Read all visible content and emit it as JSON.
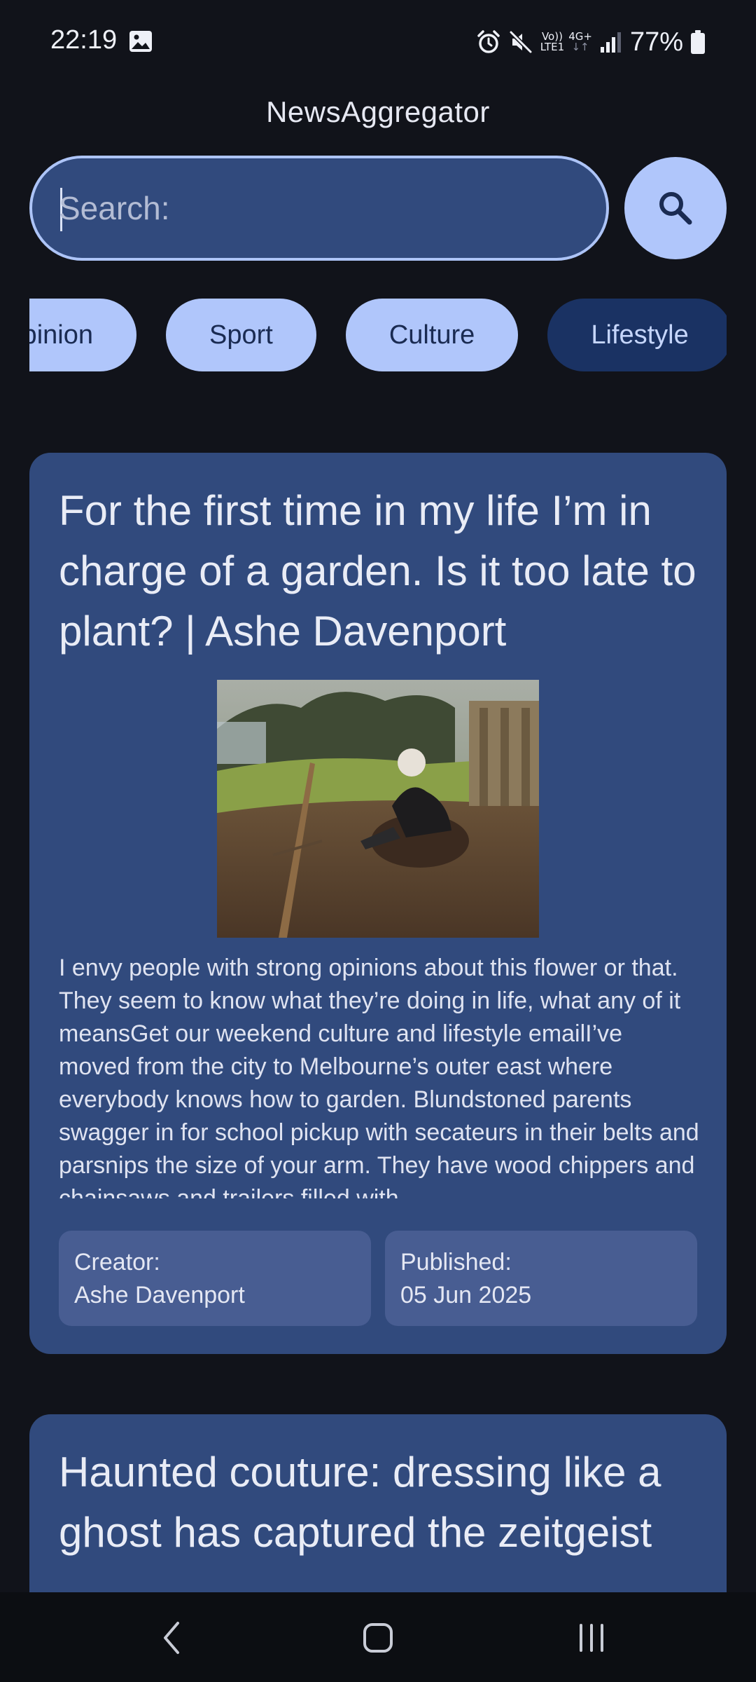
{
  "status_bar": {
    "time": "22:19",
    "network_top": "Vo))",
    "network_bottom": "LTE1",
    "network_gen": "4G+",
    "battery_percent": "77%",
    "icons": [
      "gallery-icon",
      "alarm-icon",
      "mute-icon",
      "signal-icon",
      "battery-icon"
    ]
  },
  "app": {
    "title": "NewsAggregator"
  },
  "search": {
    "placeholder": "Search:",
    "value": "",
    "button_icon": "search-icon"
  },
  "categories": {
    "items": [
      "Opinion",
      "Sport",
      "Culture",
      "Lifestyle"
    ],
    "selected": "Lifestyle"
  },
  "articles": [
    {
      "title": "For the first time in my life I’m in charge of a garden. Is it too late to plant? | Ashe Davenport",
      "image": "garden-photo",
      "summary": "I envy people with strong opinions about this flower or that. They seem to know what they’re doing in life, what any of it meansGet our weekend culture and lifestyle emailI’ve moved from the city to Melbourne’s outer east where everybody knows how to garden. Blundstoned parents swagger in for school pickup with secateurs in their belts and parsnips the size of your arm. They have wood chippers and chainsaws and trailers filled with",
      "creator_label": "Creator:",
      "creator": "Ashe Davenport",
      "published_label": "Published:",
      "published": "05 Jun 2025"
    },
    {
      "title": "Haunted couture: dressing like a ghost has captured the zeitgeist"
    }
  ],
  "nav_bar": {
    "icons": [
      "back-icon",
      "home-icon",
      "recents-icon"
    ]
  },
  "colors": {
    "background": "#11131a",
    "card": "#314a7d",
    "chip": "#b0c6fb",
    "chip_selected": "#1a3263",
    "meta_box": "#485d92",
    "accent_border": "#adc4f7"
  }
}
